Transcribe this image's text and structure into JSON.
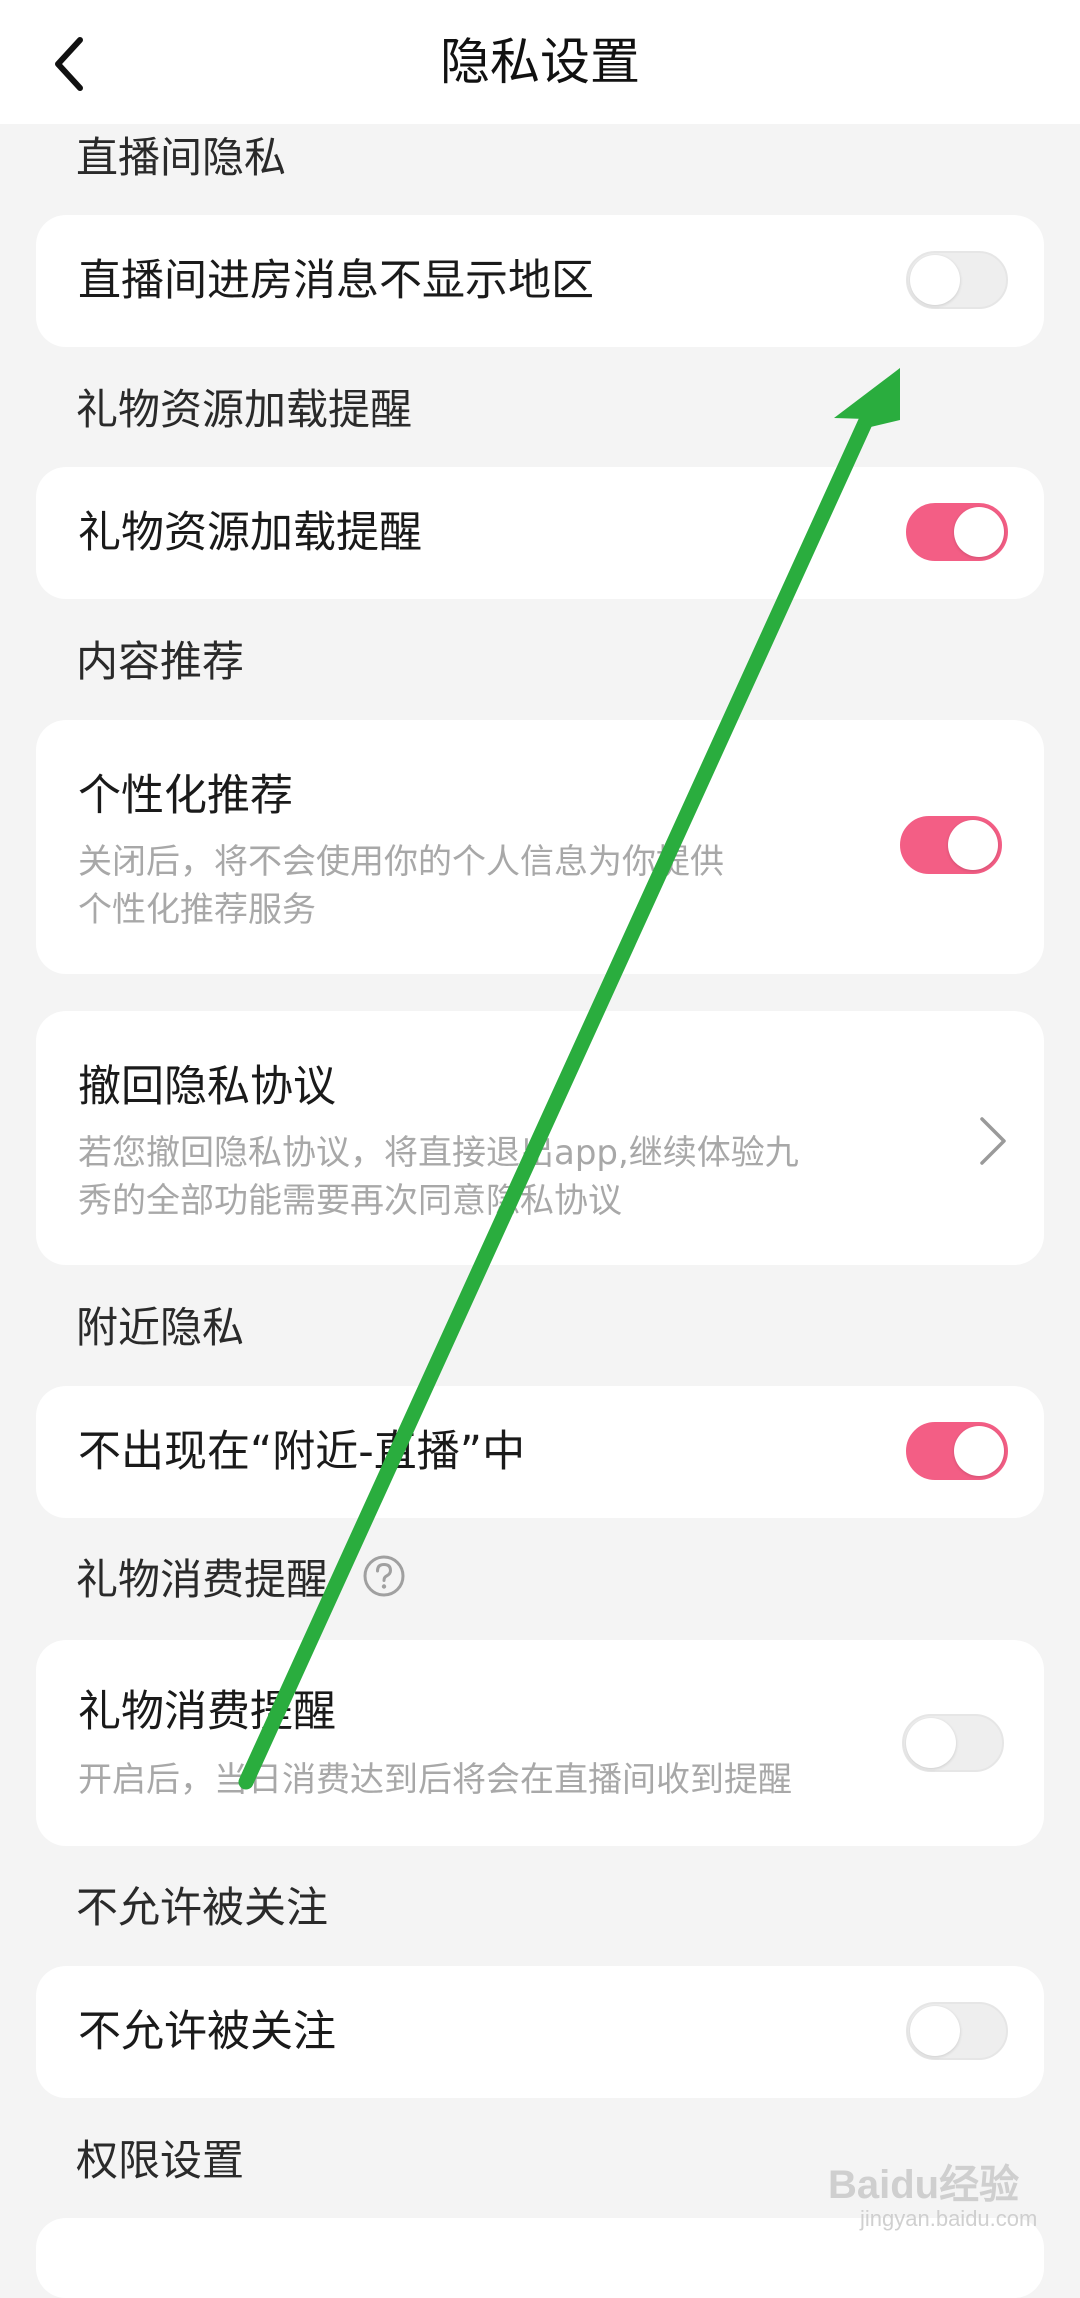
{
  "header": {
    "title": "隐私设置",
    "back_icon": "chevron-left-icon"
  },
  "sections": {
    "live_privacy": {
      "label": "直播间隐私",
      "item_title": "直播间进房消息不显示地区",
      "toggle_on": false
    },
    "gift_resource": {
      "label": "礼物资源加载提醒",
      "item_title": "礼物资源加载提醒",
      "toggle_on": true
    },
    "content_recommend": {
      "label": "内容推荐",
      "item_title": "个性化推荐",
      "item_desc_line1": "关闭后，将不会使用你的个人信息为你提供",
      "item_desc_line2": "个性化推荐服务",
      "toggle_on": true
    },
    "revoke_privacy": {
      "item_title": "撤回隐私协议",
      "item_desc_line1": "若您撤回隐私协议，将直接退出app,继续体验九",
      "item_desc_line2": "秀的全部功能需要再次同意隐私协议"
    },
    "nearby_privacy": {
      "label": "附近隐私",
      "item_title": "不出现在“附近-直播”中",
      "toggle_on": true
    },
    "gift_spend": {
      "label": "礼物消费提醒",
      "help_icon": "question-circle-icon",
      "item_title": "礼物消费提醒",
      "item_desc_line1": "开启后，当日消费达到后将会在直播间收到提醒",
      "toggle_on": false
    },
    "no_follow": {
      "label": "不允许被关注",
      "item_title": "不允许被关注",
      "toggle_on": false
    },
    "permissions": {
      "label": "权限设置"
    }
  },
  "colors": {
    "accent": "#f35e85",
    "background": "#f4f4f4",
    "card": "#ffffff",
    "annotation_arrow": "#2aad3e"
  },
  "watermark": {
    "text": "Baidu经验",
    "sub": "jingyan.baidu.com"
  }
}
